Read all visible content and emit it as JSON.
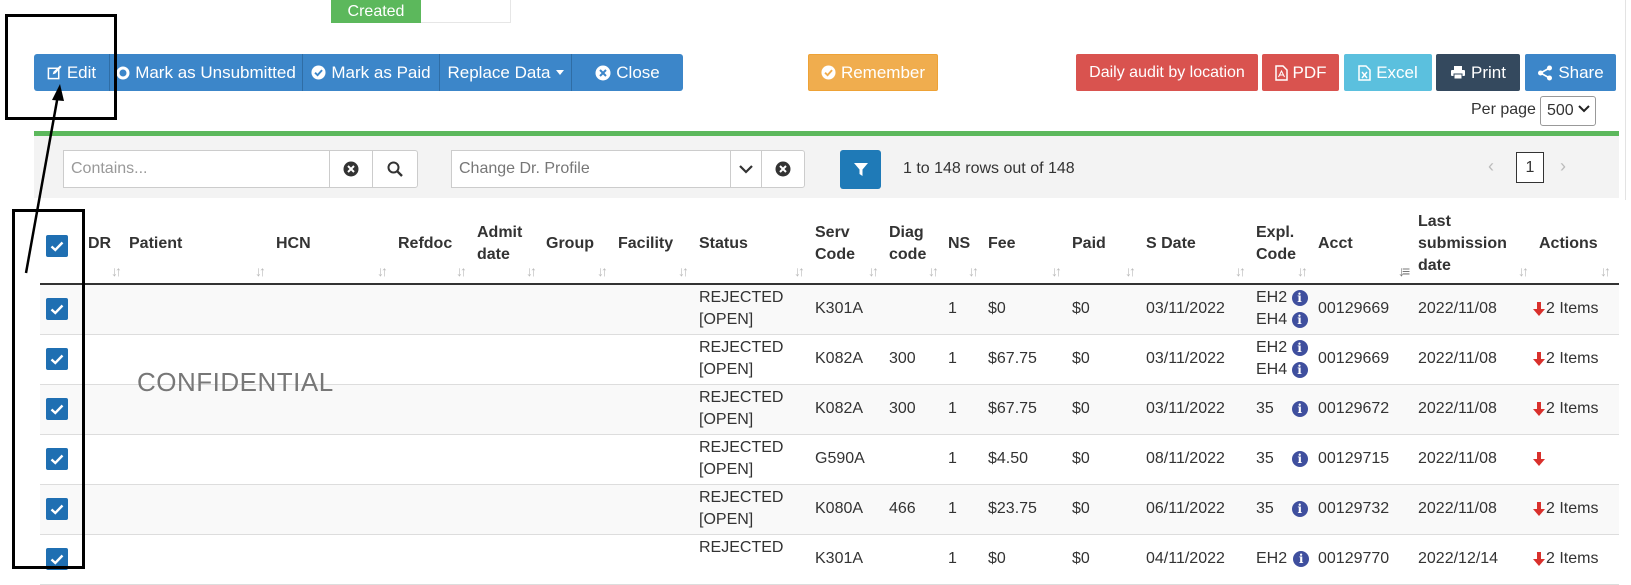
{
  "status_tab": {
    "label": "Created",
    "color": "#5cb85c"
  },
  "toolbar": {
    "edit": "Edit",
    "mark_unsubmitted": "Mark as Unsubmitted",
    "mark_paid": "Mark as Paid",
    "replace_data": "Replace Data",
    "close": "Close",
    "remember": "Remember",
    "daily_audit": "Daily audit by location",
    "pdf": "PDF",
    "excel": "Excel",
    "print": "Print",
    "share": "Share"
  },
  "per_page": {
    "label": "Per page",
    "value": "500"
  },
  "filters": {
    "contains_placeholder": "Contains...",
    "profile_placeholder": "Change Dr. Profile",
    "rows_info": "1 to 148 rows out of 148",
    "current_page": "1"
  },
  "columns": {
    "dr": "DR",
    "patient": "Patient",
    "hcn": "HCN",
    "refdoc": "Refdoc",
    "admit1": "Admit",
    "admit2": "date",
    "group": "Group",
    "facility": "Facility",
    "status": "Status",
    "serv1": "Serv",
    "serv2": "Code",
    "diag1": "Diag",
    "diag2": "code",
    "ns": "NS",
    "fee": "Fee",
    "paid": "Paid",
    "sdate": "S Date",
    "expl1": "Expl.",
    "expl2": "Code",
    "acct": "Acct",
    "last1": "Last",
    "last2": "submission",
    "last3": "date",
    "actions": "Actions"
  },
  "watermark": "CONFIDENTIAL",
  "rows": [
    {
      "status1": "REJECTED",
      "status2": "[OPEN]",
      "serv": "K301A",
      "diag": "",
      "ns": "1",
      "fee": "$0",
      "paid": "$0",
      "sdate": "03/11/2022",
      "expl1": "EH2",
      "expl2": "EH4",
      "acct": "00129669",
      "last": "2022/11/08",
      "items": "2 Items"
    },
    {
      "status1": "REJECTED",
      "status2": "[OPEN]",
      "serv": "K082A",
      "diag": "300",
      "ns": "1",
      "fee": "$67.75",
      "paid": "$0",
      "sdate": "03/11/2022",
      "expl1": "EH2",
      "expl2": "EH4",
      "acct": "00129669",
      "last": "2022/11/08",
      "items": "2 Items"
    },
    {
      "status1": "REJECTED",
      "status2": "[OPEN]",
      "serv": "K082A",
      "diag": "300",
      "ns": "1",
      "fee": "$67.75",
      "paid": "$0",
      "sdate": "03/11/2022",
      "expl1": "35",
      "expl2": "",
      "acct": "00129672",
      "last": "2022/11/08",
      "items": "2 Items"
    },
    {
      "status1": "REJECTED",
      "status2": "[OPEN]",
      "serv": "G590A",
      "diag": "",
      "ns": "1",
      "fee": "$4.50",
      "paid": "$0",
      "sdate": "08/11/2022",
      "expl1": "35",
      "expl2": "",
      "acct": "00129715",
      "last": "2022/11/08",
      "items": ""
    },
    {
      "status1": "REJECTED",
      "status2": "[OPEN]",
      "serv": "K080A",
      "diag": "466",
      "ns": "1",
      "fee": "$23.75",
      "paid": "$0",
      "sdate": "06/11/2022",
      "expl1": "35",
      "expl2": "",
      "acct": "00129732",
      "last": "2022/11/08",
      "items": "2 Items"
    },
    {
      "status1": "REJECTED",
      "status2": "",
      "serv": "K301A",
      "diag": "",
      "ns": "1",
      "fee": "$0",
      "paid": "$0",
      "sdate": "04/11/2022",
      "expl1": "EH2",
      "expl2": "",
      "acct": "00129770",
      "last": "2022/12/14",
      "items": "2 Items"
    }
  ],
  "colors": {
    "primary_blue": "#3c86c9",
    "warning": "#f0ad4e",
    "danger": "#d9534f",
    "info": "#5bc0de",
    "dark": "#34495e",
    "success": "#5cb85c",
    "checkbox": "#1f6fb2",
    "down_arrow": "#d9302c"
  }
}
